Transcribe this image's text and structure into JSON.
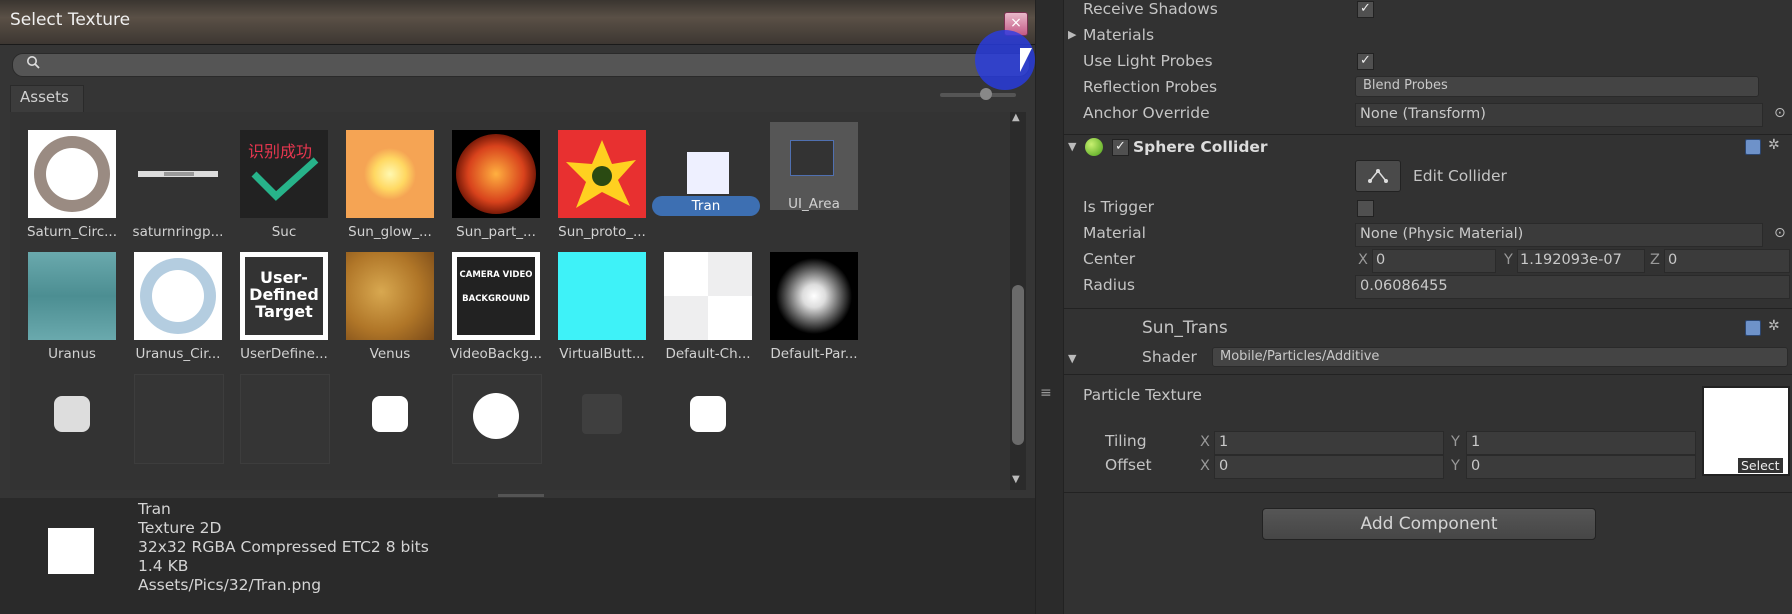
{
  "dialog": {
    "title": "Select Texture",
    "close_glyph": "×",
    "search_placeholder": "",
    "tab": "Assets",
    "grid": [
      {
        "label": "Saturn_Circ...",
        "icon": "saturn-ring-icon"
      },
      {
        "label": "saturnringp...",
        "icon": "saturn-ring-strip-icon"
      },
      {
        "label": "Suc",
        "icon": "success-check-icon",
        "text": "识别成功"
      },
      {
        "label": "Sun_glow_...",
        "icon": "sun-glow-icon"
      },
      {
        "label": "Sun_part_...",
        "icon": "sun-surface-icon"
      },
      {
        "label": "Sun_proto_...",
        "icon": "sun-proto-icon"
      },
      {
        "label": "Tran",
        "icon": "white-square-icon",
        "selected": true
      },
      {
        "label": "UI_Area",
        "icon": "ui-area-icon"
      },
      {
        "label": "Uranus",
        "icon": "uranus-texture-icon"
      },
      {
        "label": "Uranus_Cir...",
        "icon": "uranus-ring-icon"
      },
      {
        "label": "UserDefine...",
        "icon": "user-defined-target-icon",
        "text": "User-Defined Target"
      },
      {
        "label": "Venus",
        "icon": "venus-texture-icon"
      },
      {
        "label": "VideoBackg...",
        "icon": "video-background-icon",
        "text": "CAMERA VIDEO BACKGROUND"
      },
      {
        "label": "VirtualButt...",
        "icon": "virtual-button-icon"
      },
      {
        "label": "Default-Ch...",
        "icon": "default-checker-icon"
      },
      {
        "label": "Default-Par...",
        "icon": "default-particle-icon"
      }
    ],
    "preview": {
      "name": "Tran",
      "type": "Texture 2D",
      "format": "32x32  RGBA Compressed ETC2 8 bits",
      "size": "1.4 KB",
      "path": "Assets/Pics/32/Tran.png"
    }
  },
  "inspector": {
    "receive_shadows": "Receive Shadows",
    "materials": "Materials",
    "use_light_probes": "Use Light Probes",
    "reflection_probes": "Reflection Probes",
    "reflection_probes_value": "Blend Probes",
    "anchor_override": "Anchor Override",
    "anchor_override_value": "None (Transform)",
    "sphere_collider": "Sphere Collider",
    "edit_collider": "Edit Collider",
    "is_trigger": "Is Trigger",
    "material": "Material",
    "material_value": "None (Physic Material)",
    "center": "Center",
    "center_x_label": "X",
    "center_x": "0",
    "center_y_label": "Y",
    "center_y": "1.192093e-07",
    "center_z_label": "Z",
    "center_z": "0",
    "radius": "Radius",
    "radius_value": "0.06086455",
    "material_name": "Sun_Trans",
    "shader_label": "Shader",
    "shader_value": "Mobile/Particles/Additive",
    "particle_texture": "Particle Texture",
    "tiling": "Tiling",
    "offset": "Offset",
    "tiling_x_label": "X",
    "tiling_x": "1",
    "tiling_y_label": "Y",
    "tiling_y": "1",
    "offset_x_label": "X",
    "offset_x": "0",
    "offset_y_label": "Y",
    "offset_y": "0",
    "select": "Select",
    "add_component": "Add Component"
  }
}
